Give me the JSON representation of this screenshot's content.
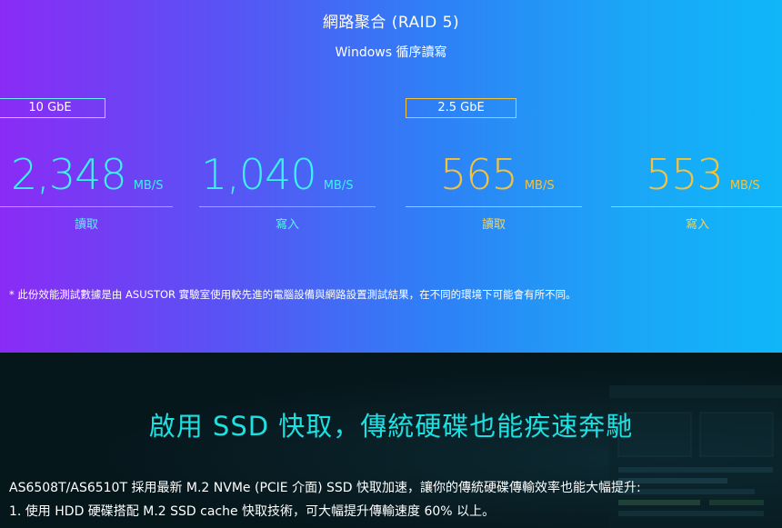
{
  "performance": {
    "title": "網路聚合 (RAID 5)",
    "subtitle": "Windows 循序讀寫",
    "badges": {
      "ten_gbe": "10 GbE",
      "two_five_gbe": "2.5 GbE"
    },
    "metrics": [
      {
        "value": "2,348",
        "unit": "MB/S",
        "label": "讀取",
        "color": "#3ef0ef"
      },
      {
        "value": "1,040",
        "unit": "MB/S",
        "label": "寫入",
        "color": "#3ef0ef"
      },
      {
        "value": "565",
        "unit": "MB/S",
        "label": "讀取",
        "color": "#f5c23d"
      },
      {
        "value": "553",
        "unit": "MB/S",
        "label": "寫入",
        "color": "#f5c23d"
      }
    ],
    "note": "* 此份效能測試數據是由 ASUSTOR 實驗室使用較先進的電腦設備與網路設置測試結果，在不同的環境下可能會有所不同。"
  },
  "ssd_section": {
    "title": "啟用 SSD 快取，傳統硬碟也能疾速奔馳",
    "paragraph_1": "AS6508T/AS6510T 採用最新 M.2 NVMe (PCIE 介面) SSD 快取加速，讓你的傳統硬碟傳輸效率也能大幅提升:",
    "paragraph_2": "1. 使用 HDD 硬碟搭配 M.2 SSD cache 快取技術，可大幅提升傳輸速度 60% 以上。",
    "accent_color": "#1fe0e0"
  },
  "colors": {
    "gradient_start": "#8a2bf5",
    "gradient_end": "#0fb6f8",
    "cyan": "#3ef0ef",
    "gold": "#f5c23d",
    "dark_bg": "#06171c"
  }
}
